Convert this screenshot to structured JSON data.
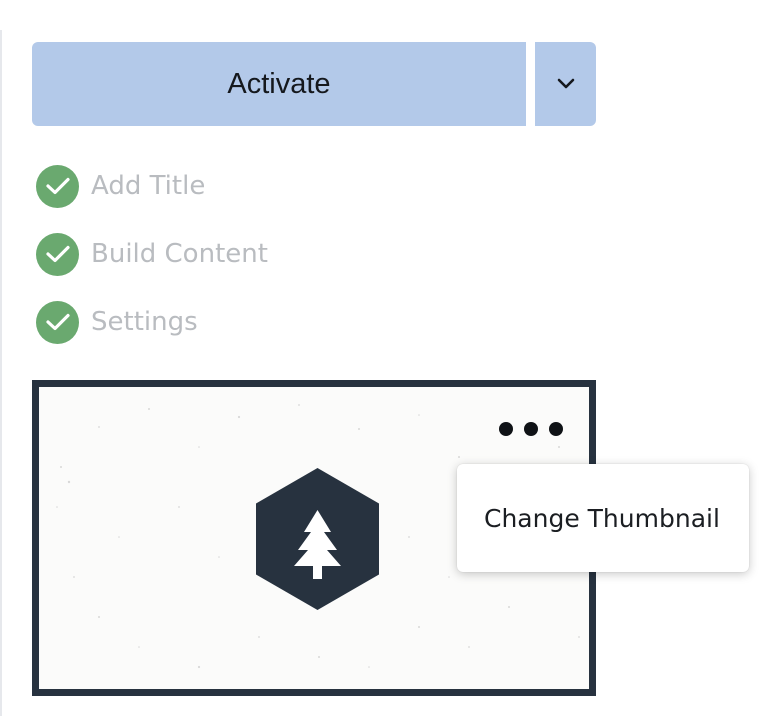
{
  "activate": {
    "label": "Activate",
    "dropdown_icon": "chevron-down-icon",
    "color": "#b3c9e9"
  },
  "checklist": {
    "items": [
      {
        "label": "Add Title",
        "icon": "check-circle-icon",
        "status": "complete"
      },
      {
        "label": "Build Content",
        "icon": "check-circle-icon",
        "status": "complete"
      },
      {
        "label": "Settings",
        "icon": "check-circle-icon",
        "status": "complete"
      }
    ],
    "check_color": "#6aa96f"
  },
  "thumbnail": {
    "icon": "pine-tree-icon",
    "badge_color": "#27323f",
    "more_icon": "more-horizontal-icon"
  },
  "menu": {
    "items": [
      {
        "label": "Change Thumbnail"
      }
    ]
  }
}
